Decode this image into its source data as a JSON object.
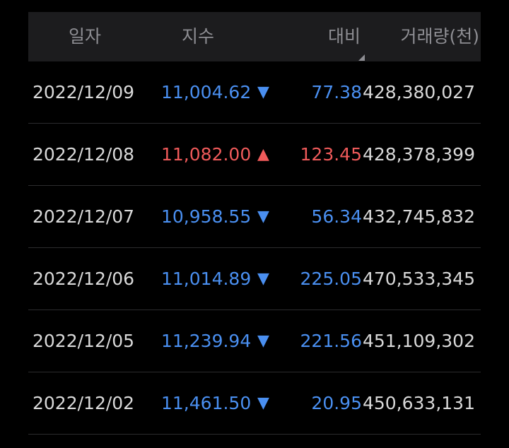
{
  "colors": {
    "background": "#000000",
    "header_bg": "#1c1c1e",
    "header_text": "#8e8e93",
    "down": "#4a8ff0",
    "up": "#ef5a5a",
    "text": "#d9d9d9",
    "divider": "#2c2c2e"
  },
  "header": {
    "date": "일자",
    "index": "지수",
    "change": "대비",
    "volume": "거래량(천)"
  },
  "rows": [
    {
      "date": "2022/12/09",
      "index": "11,004.62",
      "arrow": "▼",
      "change": "77.38",
      "volume": "428,380,027",
      "direction": "down"
    },
    {
      "date": "2022/12/08",
      "index": "11,082.00",
      "arrow": "▲",
      "change": "123.45",
      "volume": "428,378,399",
      "direction": "up"
    },
    {
      "date": "2022/12/07",
      "index": "10,958.55",
      "arrow": "▼",
      "change": "56.34",
      "volume": "432,745,832",
      "direction": "down"
    },
    {
      "date": "2022/12/06",
      "index": "11,014.89",
      "arrow": "▼",
      "change": "225.05",
      "volume": "470,533,345",
      "direction": "down"
    },
    {
      "date": "2022/12/05",
      "index": "11,239.94",
      "arrow": "▼",
      "change": "221.56",
      "volume": "451,109,302",
      "direction": "down"
    },
    {
      "date": "2022/12/02",
      "index": "11,461.50",
      "arrow": "▼",
      "change": "20.95",
      "volume": "450,633,131",
      "direction": "down"
    }
  ]
}
